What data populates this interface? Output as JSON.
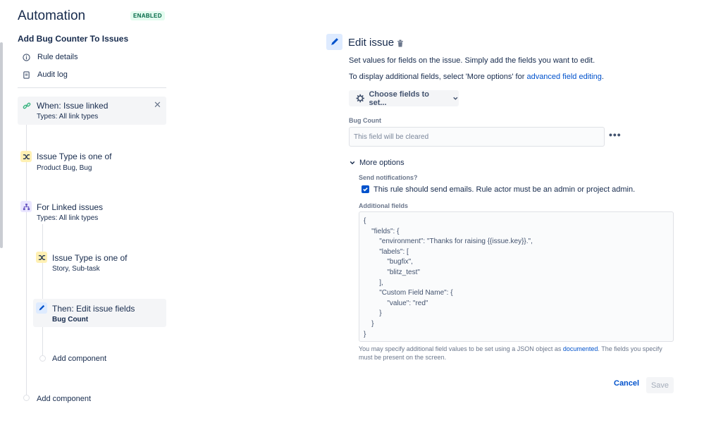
{
  "header": {
    "title": "Automation",
    "status_badge": "ENABLED"
  },
  "rule": {
    "name": "Add Bug Counter To Issues"
  },
  "nav": {
    "rule_details": "Rule details",
    "audit_log": "Audit log"
  },
  "components": [
    {
      "title": "When: Issue linked",
      "subtitle": "Types: All link types",
      "icon": "link-icon",
      "color": "#36b37e"
    },
    {
      "title": "Issue Type is one of",
      "subtitle": "Product Bug, Bug",
      "icon": "shuffle-icon",
      "color": "#ffab00"
    },
    {
      "title": "For Linked issues",
      "subtitle": "Types: All link types",
      "icon": "branch-icon",
      "color": "#6554c0"
    },
    {
      "title": "Issue Type is one of",
      "subtitle": "Story, Sub-task",
      "icon": "shuffle-icon",
      "color": "#ffab00"
    },
    {
      "title": "Then: Edit issue fields",
      "subtitle": "Bug Count",
      "icon": "pencil-icon",
      "color": "#0052cc"
    }
  ],
  "add_component": "Add component",
  "editor": {
    "title": "Edit issue",
    "description_1": "Set values for fields on the issue. Simply add the fields you want to edit.",
    "description_2_prefix": "To display additional fields, select 'More options' for ",
    "description_2_link": "advanced field editing",
    "description_2_suffix": ".",
    "choose_fields": "Choose fields to set...",
    "field_label": "Bug Count",
    "field_placeholder": "This field will be cleared",
    "more_options": "More options",
    "send_notifications_label": "Send notifications?",
    "checkbox_label": "This rule should send emails. Rule actor must be an admin or project admin.",
    "additional_fields_label": "Additional fields",
    "additional_fields_json": "{\n    \"fields\": {\n        \"environment\": \"Thanks for raising {{issue.key}}.\",\n        \"labels\": [\n            \"bugfix\",\n            \"blitz_test\"\n        ],\n        \"Custom Field Name\": {\n            \"value\": \"red\"\n        }\n    }\n}",
    "help_prefix": "You may specify additional field values to be set using a JSON object as ",
    "help_link": "documented",
    "help_suffix": ". The fields you specify must be present on the screen.",
    "cancel": "Cancel",
    "save": "Save"
  }
}
